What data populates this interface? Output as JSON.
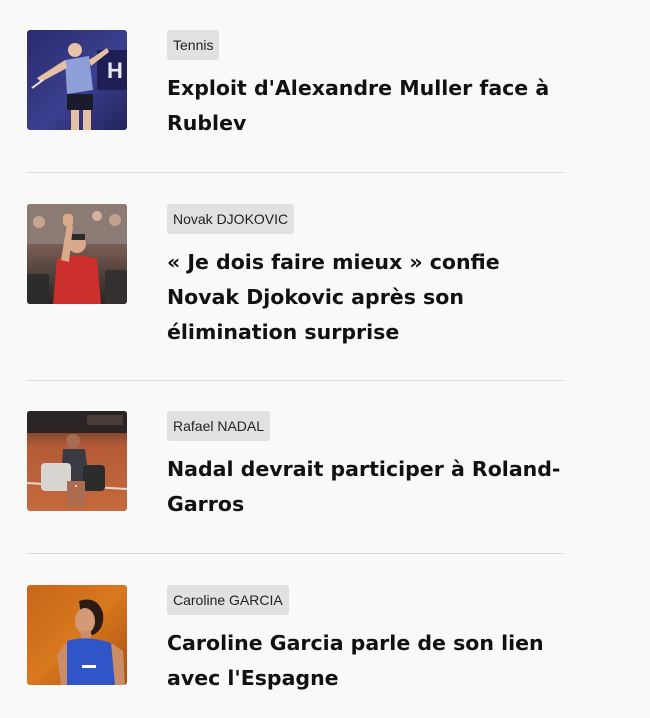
{
  "articles": [
    {
      "tag": "Tennis",
      "title": "Exploit d'Alexandre Muller face à Rublev"
    },
    {
      "tag": "Novak DJOKOVIC",
      "title": "« Je dois faire mieux » confie Novak Djokovic après son élimination surprise"
    },
    {
      "tag": "Rafael NADAL",
      "title": "Nadal devrait participer à Roland-Garros"
    },
    {
      "tag": "Caroline GARCIA",
      "title": "Caroline Garcia parle de son lien avec l'Espagne"
    }
  ]
}
